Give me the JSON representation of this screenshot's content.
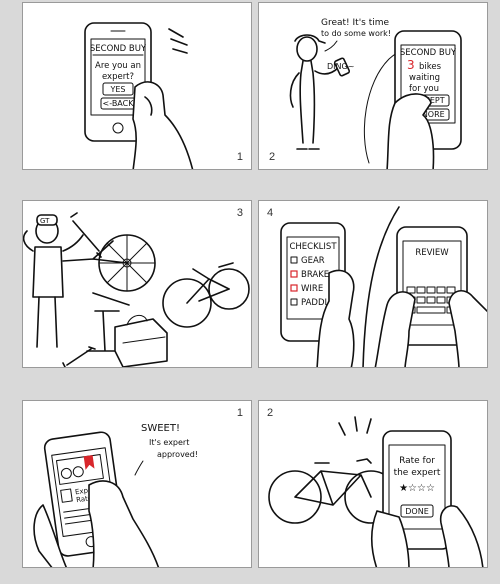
{
  "panels": [
    {
      "number": "1",
      "phone": {
        "title": "SECOND BUY",
        "prompt_line1": "Are you an",
        "prompt_line2": "expert?",
        "yes": "YES",
        "back": "<-BACK"
      }
    },
    {
      "number": "2",
      "speech_line1": "Great! It's time",
      "speech_line2": "to do some work!",
      "sound": "DING~",
      "phone": {
        "title": "SECOND BUY",
        "count": "3",
        "line1": "bikes",
        "line2": "waiting",
        "line3": "for you",
        "accept": "ACCEPT",
        "ignore": "IGNORE"
      }
    },
    {
      "number": "3",
      "cap_text": "GT"
    },
    {
      "number": "4",
      "phone_left": {
        "title": "CHECKLIST",
        "items": [
          "GEAR",
          "BRAKE",
          "WIRE",
          "PADDLE"
        ]
      },
      "phone_right": {
        "title": "REVIEW"
      }
    },
    {
      "number": "1",
      "speech_line1": "SWEET!",
      "speech_line2": "It's expert",
      "speech_line3": "approved!",
      "phone": {
        "row_text_line1": "Exp",
        "row_text_line2": "Rate"
      }
    },
    {
      "number": "2",
      "phone": {
        "line1": "Rate for",
        "line2": "the expert",
        "stars": "★☆☆☆",
        "done": "DONE"
      }
    }
  ],
  "colors": {
    "accent_red": "#d8262b"
  }
}
